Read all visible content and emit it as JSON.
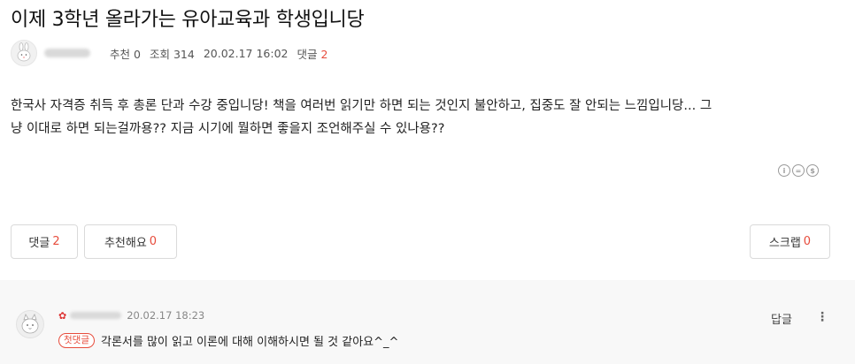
{
  "post": {
    "title": "이제 3학년 올라가는 유아교육과 학생입니당",
    "meta": {
      "recommend_label": "추천",
      "recommend_count": "0",
      "views_label": "조회",
      "views_count": "314",
      "datetime": "20.02.17 16:02",
      "comments_label": "댓글",
      "comments_count": "2"
    },
    "body_line1": "한국사 자격증 취득 후 총론 단과 수강 중입니당! 책을 여러번 읽기만 하면 되는 것인지 불안하고, 집중도 잘 안되는 느낌입니당... 그",
    "body_line2": "냥 이대로 하면 되는걸까용?? 지금 시기에 뭘하면 좋을지 조언해주실 수 있나용??",
    "license_icons": [
      "creative-commons-by-icon",
      "creative-commons-nd-icon",
      "creative-commons-nc-icon"
    ]
  },
  "buttons": {
    "comments_label": "댓글",
    "comments_count": "2",
    "recommend_label": "추천해요",
    "recommend_count": "0",
    "scrap_label": "스크랩",
    "scrap_count": "0"
  },
  "comment": {
    "datetime": "20.02.17 18:23",
    "badge": "첫댓글",
    "text": "각론서를 많이 읽고 이론에 대해 이해하시면 될 것 같아요^_^",
    "reply_label": "답글",
    "more_icon": "kebab-menu-icon"
  },
  "colors": {
    "accent_red": "#e74c3c",
    "comment_bg": "#f8f8f8"
  }
}
